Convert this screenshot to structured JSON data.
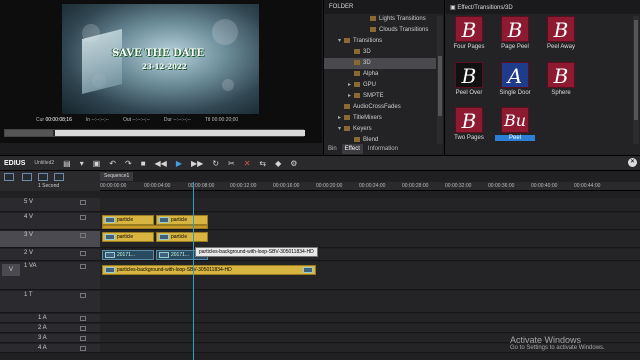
{
  "player": {
    "title": "SAVE THE DATE",
    "date": "23-12-2022",
    "cur_label": "Cur",
    "cur_value": "00:00:08;16",
    "in_label": "In",
    "in_value": "--:--:--;--",
    "out_label": "Out",
    "out_value": "--:--:--;--",
    "dur_label": "Dur",
    "dur_value": "--:--:--;--",
    "ttl_label": "Ttl",
    "ttl_value": "00:00:20;00"
  },
  "folder_panel": {
    "header": "FOLDER",
    "items": [
      {
        "label": "Lights Transitions",
        "indent": 3
      },
      {
        "label": "Clouds Transitions",
        "indent": 3
      },
      {
        "label": "Transitions",
        "indent": 1
      },
      {
        "label": "3D",
        "indent": 2
      },
      {
        "label": "3D",
        "indent": 2
      },
      {
        "label": "Alpha",
        "indent": 2
      },
      {
        "label": "GPU",
        "indent": 2
      },
      {
        "label": "SMPTE",
        "indent": 2
      },
      {
        "label": "AudioCrossFades",
        "indent": 1
      },
      {
        "label": "TitleMixers",
        "indent": 1
      },
      {
        "label": "Keyers",
        "indent": 1
      },
      {
        "label": "Blend",
        "indent": 2
      }
    ],
    "tabs": [
      "Bin",
      "Effect",
      "Information"
    ]
  },
  "effect_panel": {
    "path": "Effect/Transitions/3D",
    "items": [
      {
        "label": "Four Pages",
        "glyph": "B"
      },
      {
        "label": "Page Peel",
        "glyph": "B"
      },
      {
        "label": "Peel Away",
        "glyph": "B"
      },
      {
        "label": "Peel Over",
        "glyph": "B"
      },
      {
        "label": "Single Door",
        "glyph": "A"
      },
      {
        "label": "Sphere",
        "glyph": "B"
      },
      {
        "label": "Two Pages",
        "glyph": "B"
      },
      {
        "label": "Peel",
        "glyph": "Bu"
      }
    ]
  },
  "toolbar": {
    "app": "EDIUS",
    "project": "Untitled2"
  },
  "timeline": {
    "sequence_tab": "Sequence1",
    "zoom": "1 Second",
    "ruler": [
      "00:00:00:00",
      "00:00:04:00",
      "00:00:08:00",
      "00:00:12:00",
      "00:00:16:00",
      "00:00:20:00",
      "00:00:24:00",
      "00:00:28:00",
      "00:00:32:00",
      "00:00:36:00",
      "00:00:40:00",
      "00:00:44:00"
    ],
    "tracks": [
      "5 V",
      "4 V",
      "3 V",
      "2 V",
      "1 VA",
      "1 T",
      "1 A",
      "2 A",
      "3 A",
      "4 A"
    ],
    "clip_particle": "particle",
    "clip_video": "20171...",
    "clip_bg": "particles-background-with-loop-SBV-305011834-HD",
    "tooltip": "particles-background-with-loop-SBV-305011834-HD"
  },
  "watermark": {
    "line1": "Activate Windows",
    "line2": "Go to Settings to activate Windows."
  }
}
